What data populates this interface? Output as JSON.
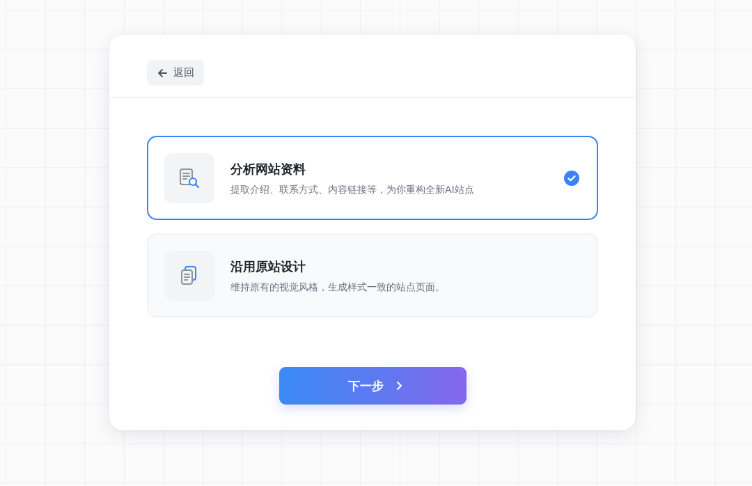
{
  "header": {
    "back_button": {
      "label": "返回"
    }
  },
  "options": [
    {
      "title": "分析网站资料",
      "description": "提取介绍、联系方式、内容链接等，为你重构全新AI站点",
      "selected": true
    },
    {
      "title": "沿用原站设计",
      "description": "维持原有的视觉风格，生成样式一致的站点页面。",
      "selected": false
    }
  ],
  "next_button": {
    "label": "下一步"
  }
}
